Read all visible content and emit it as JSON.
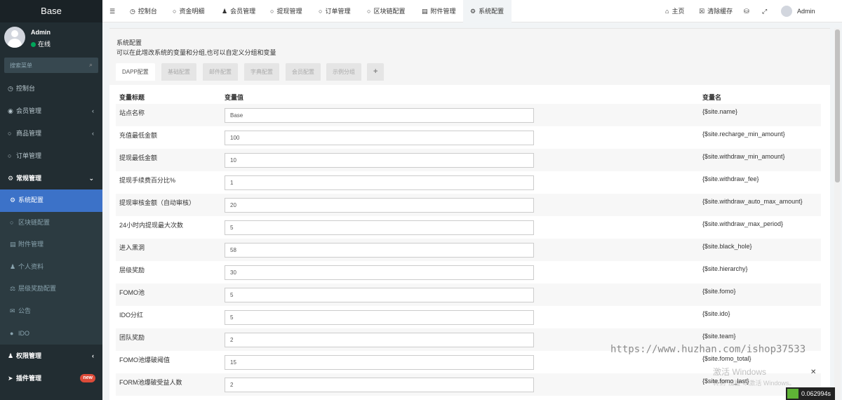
{
  "sidebar": {
    "brand": "Base",
    "user": {
      "name": "Admin",
      "status": "在线"
    },
    "search_placeholder": "搜索菜单",
    "items": [
      {
        "label": "控制台",
        "icon": "dashboard-icon"
      },
      {
        "label": "会员管理",
        "icon": "user-icon"
      },
      {
        "label": "商品管理",
        "icon": "circle-icon"
      },
      {
        "label": "订单管理",
        "icon": "circle-icon"
      },
      {
        "label": "常规管理",
        "icon": "cogs-icon"
      }
    ],
    "sub_items": [
      {
        "label": "系统配置",
        "icon": "gear-icon",
        "active": true
      },
      {
        "label": "区块链配置",
        "icon": "circle-icon"
      },
      {
        "label": "附件管理",
        "icon": "file-icon"
      },
      {
        "label": "个人资料",
        "icon": "user-icon"
      },
      {
        "label": "层级奖励配置",
        "icon": "scale-icon"
      },
      {
        "label": "公告",
        "icon": "bullhorn-icon"
      },
      {
        "label": "IDO",
        "icon": "globe-icon"
      }
    ],
    "bottom_items": [
      {
        "label": "权限管理",
        "icon": "group-icon"
      },
      {
        "label": "插件管理",
        "icon": "rocket-icon",
        "badge": "new"
      }
    ]
  },
  "topbar": {
    "tabs": [
      {
        "label": "控制台",
        "icon": "dashboard-icon"
      },
      {
        "label": "资金明细",
        "icon": "circle-icon"
      },
      {
        "label": "会员管理",
        "icon": "user-icon"
      },
      {
        "label": "提现管理",
        "icon": "circle-icon"
      },
      {
        "label": "订单管理",
        "icon": "circle-icon"
      },
      {
        "label": "区块链配置",
        "icon": "circle-icon"
      },
      {
        "label": "附件管理",
        "icon": "file-icon"
      },
      {
        "label": "系统配置",
        "icon": "gear-icon",
        "active": true
      }
    ],
    "home_label": "主页",
    "clear_cache_label": "清除缓存",
    "admin_label": "Admin"
  },
  "panel": {
    "title": "系统配置",
    "description": "可以在此增改系统的变量和分组,也可以自定义分组和变量",
    "tabs": [
      "DAPP配置",
      "基础配置",
      "邮件配置",
      "字典配置",
      "会员配置",
      "示例分组"
    ],
    "add_tab_label": "+",
    "columns": {
      "title": "变量标题",
      "value": "变量值",
      "name": "变量名"
    },
    "rows": [
      {
        "title": "站点名称",
        "value": "Base",
        "name": "{$site.name}"
      },
      {
        "title": "充值最低金额",
        "value": "100",
        "name": "{$site.recharge_min_amount}"
      },
      {
        "title": "提现最低金额",
        "value": "10",
        "name": "{$site.withdraw_min_amount}"
      },
      {
        "title": "提现手续费百分比%",
        "value": "1",
        "name": "{$site.withdraw_fee}"
      },
      {
        "title": "提现审核金额（自动审核）",
        "value": "20",
        "name": "{$site.withdraw_auto_max_amount}"
      },
      {
        "title": "24小时内提现最大次数",
        "value": "5",
        "name": "{$site.withdraw_max_period}"
      },
      {
        "title": "进入黑洞",
        "value": "58",
        "name": "{$site.black_hole}"
      },
      {
        "title": "层级奖励",
        "value": "30",
        "name": "{$site.hierarchy}"
      },
      {
        "title": "FOMO池",
        "value": "5",
        "name": "{$site.fomo}"
      },
      {
        "title": "IDO分红",
        "value": "5",
        "name": "{$site.ido}"
      },
      {
        "title": "团队奖励",
        "value": "2",
        "name": "{$site.team}"
      },
      {
        "title": "FOMO池爆破阈值",
        "value": "15",
        "name": "{$site.fomo_total}"
      },
      {
        "title": "FORM池爆破受益人数",
        "value": "2",
        "name": "{$site.fomo_last}"
      }
    ]
  },
  "overlay": {
    "watermark": "https://www.huzhan.com/ishop37533",
    "activate_title": "激活 Windows",
    "activate_sub": "转到\"设置\"以激活 Windows。",
    "timer": "0.062994s"
  }
}
